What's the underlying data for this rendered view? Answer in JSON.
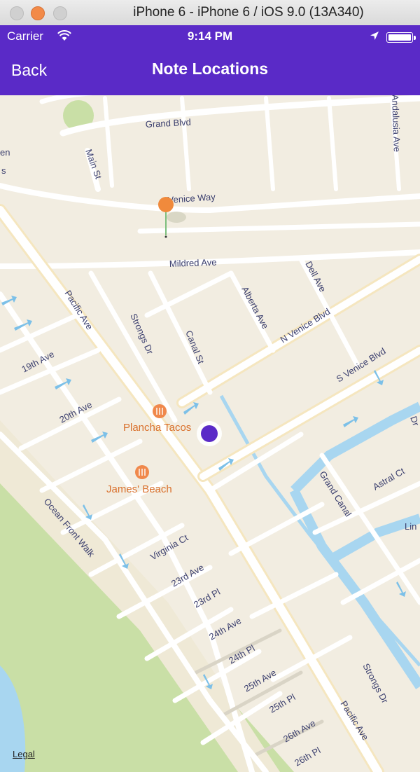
{
  "window": {
    "title": "iPhone 6 - iPhone 6 / iOS 9.0 (13A340)"
  },
  "status_bar": {
    "carrier": "Carrier",
    "time": "9:14 PM"
  },
  "nav_bar": {
    "back_label": "Back",
    "title": "Note Locations"
  },
  "map": {
    "legal_label": "Legal",
    "streets": {
      "grand_blvd": "Grand Blvd",
      "main_st": "Main St",
      "venice_way": "Venice Way",
      "andalusia_ave": "Andalusia Ave",
      "mildred_ave": "Mildred Ave",
      "dell_ave": "Dell Ave",
      "pacific_ave_top": "Pacific Ave",
      "strongs_dr_top": "Strongs Dr",
      "canal_st": "Canal St",
      "alberta_ave": "Alberta Ave",
      "n_venice_blvd": "N Venice Blvd",
      "s_venice_blvd": "S Venice Blvd",
      "19th_ave": "19th Ave",
      "20th_ave": "20th Ave",
      "ocean_front_walk": "Ocean Front Walk",
      "virginia_ct": "Virginia Ct",
      "23rd_ave": "23rd Ave",
      "23rd_pl": "23rd Pl",
      "24th_ave": "24th Ave",
      "24th_pl": "24th Pl",
      "25th_ave": "25th Ave",
      "25th_pl": "25th Pl",
      "26th_ave": "26th Ave",
      "26th_pl": "26th Pl",
      "grand_canal": "Grand Canal",
      "astral_ct": "Astral Ct",
      "strongs_dr_bottom": "Strongs Dr",
      "pacific_ave_bottom": "Pacific Ave",
      "partial_left_1": "en",
      "partial_left_2": "s",
      "partial_right_1": "Dr",
      "partial_right_2": "Lin"
    },
    "pois": [
      {
        "name": "Plancha Tacos",
        "icon": "restaurant-icon"
      },
      {
        "name": "James' Beach",
        "icon": "restaurant-icon"
      }
    ],
    "note_pin": {
      "icon": "map-pin-icon",
      "color": "#f08a3c"
    },
    "user_location": {
      "icon": "user-location-dot",
      "color": "#5a2ac7"
    }
  },
  "colors": {
    "brand": "#5a2ac7",
    "map_land": "#f2ede1",
    "road": "#ffffff",
    "park": "#c9dfa6",
    "water": "#a8d6f0"
  }
}
